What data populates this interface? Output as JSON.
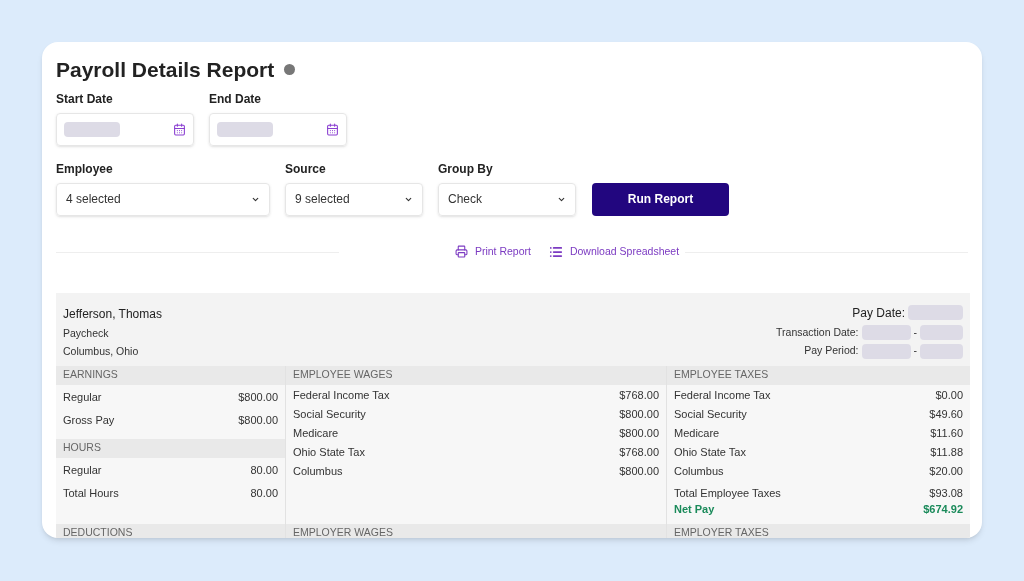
{
  "title": "Payroll Details Report",
  "date_fields": [
    {
      "label": "Start Date"
    },
    {
      "label": "End Date"
    }
  ],
  "selects": [
    {
      "label": "Employee",
      "value": "4 selected"
    },
    {
      "label": "Source",
      "value": "9 selected"
    },
    {
      "label": "Group By",
      "value": "Check"
    }
  ],
  "run_button": "Run Report",
  "links": [
    {
      "kind": "print",
      "label": "Print Report"
    },
    {
      "kind": "spreadsheet",
      "label": "Download Spreadsheet"
    }
  ],
  "employee": {
    "name": "Jefferson, Thomas",
    "type": "Paycheck",
    "location": "Columbus, Ohio"
  },
  "pay_info": [
    {
      "kind": "single",
      "label": "Pay Date:"
    },
    {
      "kind": "range",
      "label": "Transaction Date:",
      "separator": "-"
    },
    {
      "kind": "range",
      "label": "Pay Period:",
      "separator": "-"
    }
  ],
  "columns": [
    {
      "sections": [
        {
          "heading": "EARNINGS",
          "rows": [
            {
              "kind": "item",
              "label": "Regular",
              "value": "$800.00"
            },
            {
              "kind": "item",
              "label": "Gross Pay",
              "value": "$800.00"
            }
          ]
        },
        {
          "heading": "HOURS",
          "rows": [
            {
              "kind": "item",
              "label": "Regular",
              "value": "80.00"
            },
            {
              "kind": "item",
              "label": "Total Hours",
              "value": "80.00"
            }
          ]
        },
        {
          "heading": "DEDUCTIONS"
        }
      ]
    },
    {
      "sections": [
        {
          "heading": "EMPLOYEE WAGES",
          "rows": [
            {
              "kind": "item",
              "label": "Federal Income Tax",
              "value": "$768.00"
            },
            {
              "kind": "item",
              "label": "Social Security",
              "value": "$800.00"
            },
            {
              "kind": "item",
              "label": "Medicare",
              "value": "$800.00"
            },
            {
              "kind": "item",
              "label": "Ohio State Tax",
              "value": "$768.00"
            },
            {
              "kind": "item",
              "label": "Columbus",
              "value": "$800.00"
            }
          ]
        },
        {
          "heading": "EMPLOYER WAGES"
        }
      ]
    },
    {
      "sections": [
        {
          "heading": "EMPLOYEE TAXES",
          "rows": [
            {
              "kind": "item",
              "label": "Federal Income Tax",
              "value": "$0.00"
            },
            {
              "kind": "item",
              "label": "Social Security",
              "value": "$49.60"
            },
            {
              "kind": "item",
              "label": "Medicare",
              "value": "$11.60"
            },
            {
              "kind": "item",
              "label": "Ohio State Tax",
              "value": "$11.88"
            },
            {
              "kind": "item",
              "label": "Columbus",
              "value": "$20.00"
            },
            {
              "kind": "total",
              "label": "Total Employee Taxes",
              "value": "$93.08"
            },
            {
              "kind": "net",
              "label": "Net Pay",
              "value": "$674.92"
            }
          ]
        },
        {
          "heading": "EMPLOYER TAXES"
        }
      ]
    }
  ]
}
